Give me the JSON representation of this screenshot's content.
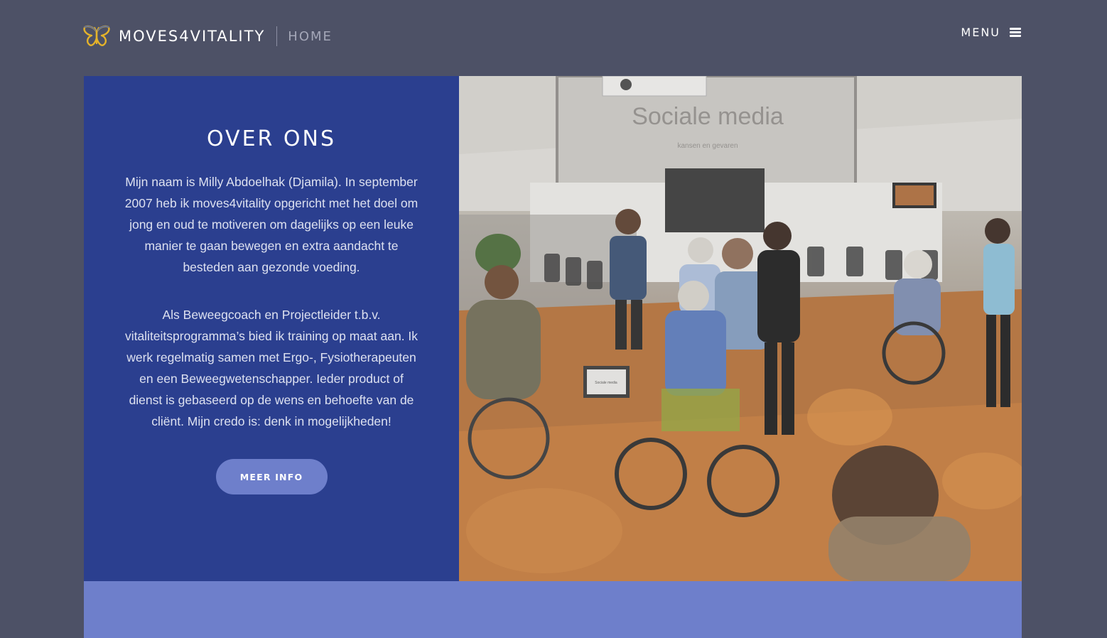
{
  "header": {
    "brand_name": "MOVES4VITALITY",
    "section": "HOME",
    "menu_label": "MENU",
    "logo_icon": "butterfly-icon",
    "menu_icon": "hamburger-icon"
  },
  "intro": {
    "title": "OVER ONS",
    "paragraph_1": "Mijn naam is Milly Abdoelhak (Djamila). In september 2007 heb ik moves4vitality opgericht met het doel om jong en oud te motiveren om dagelijks op een leuke manier te gaan bewegen en extra aandacht te besteden aan gezonde voeding.",
    "paragraph_2": "Als Beweegcoach en Projectleider t.b.v. vitaliteitsprogramma’s bied ik training op maat aan. Ik werk regelmatig samen met Ergo-, Fysiotherapeuten en een Beweegwetenschapper. Ieder product of dienst is gebaseerd op de wens en behoefte van de cliënt. Mijn credo is: denk in mogelijkheden!",
    "button_label": "MEER INFO"
  },
  "photo": {
    "screen_title": "Sociale media",
    "screen_subtitle": "kansen en gevaren",
    "laptop_text": "Sociale media"
  },
  "colors": {
    "page_background": "#4d5166",
    "intro_background": "#2b3f8f",
    "accent": "#6e7fcb",
    "logo_gold": "#e5b32a"
  }
}
